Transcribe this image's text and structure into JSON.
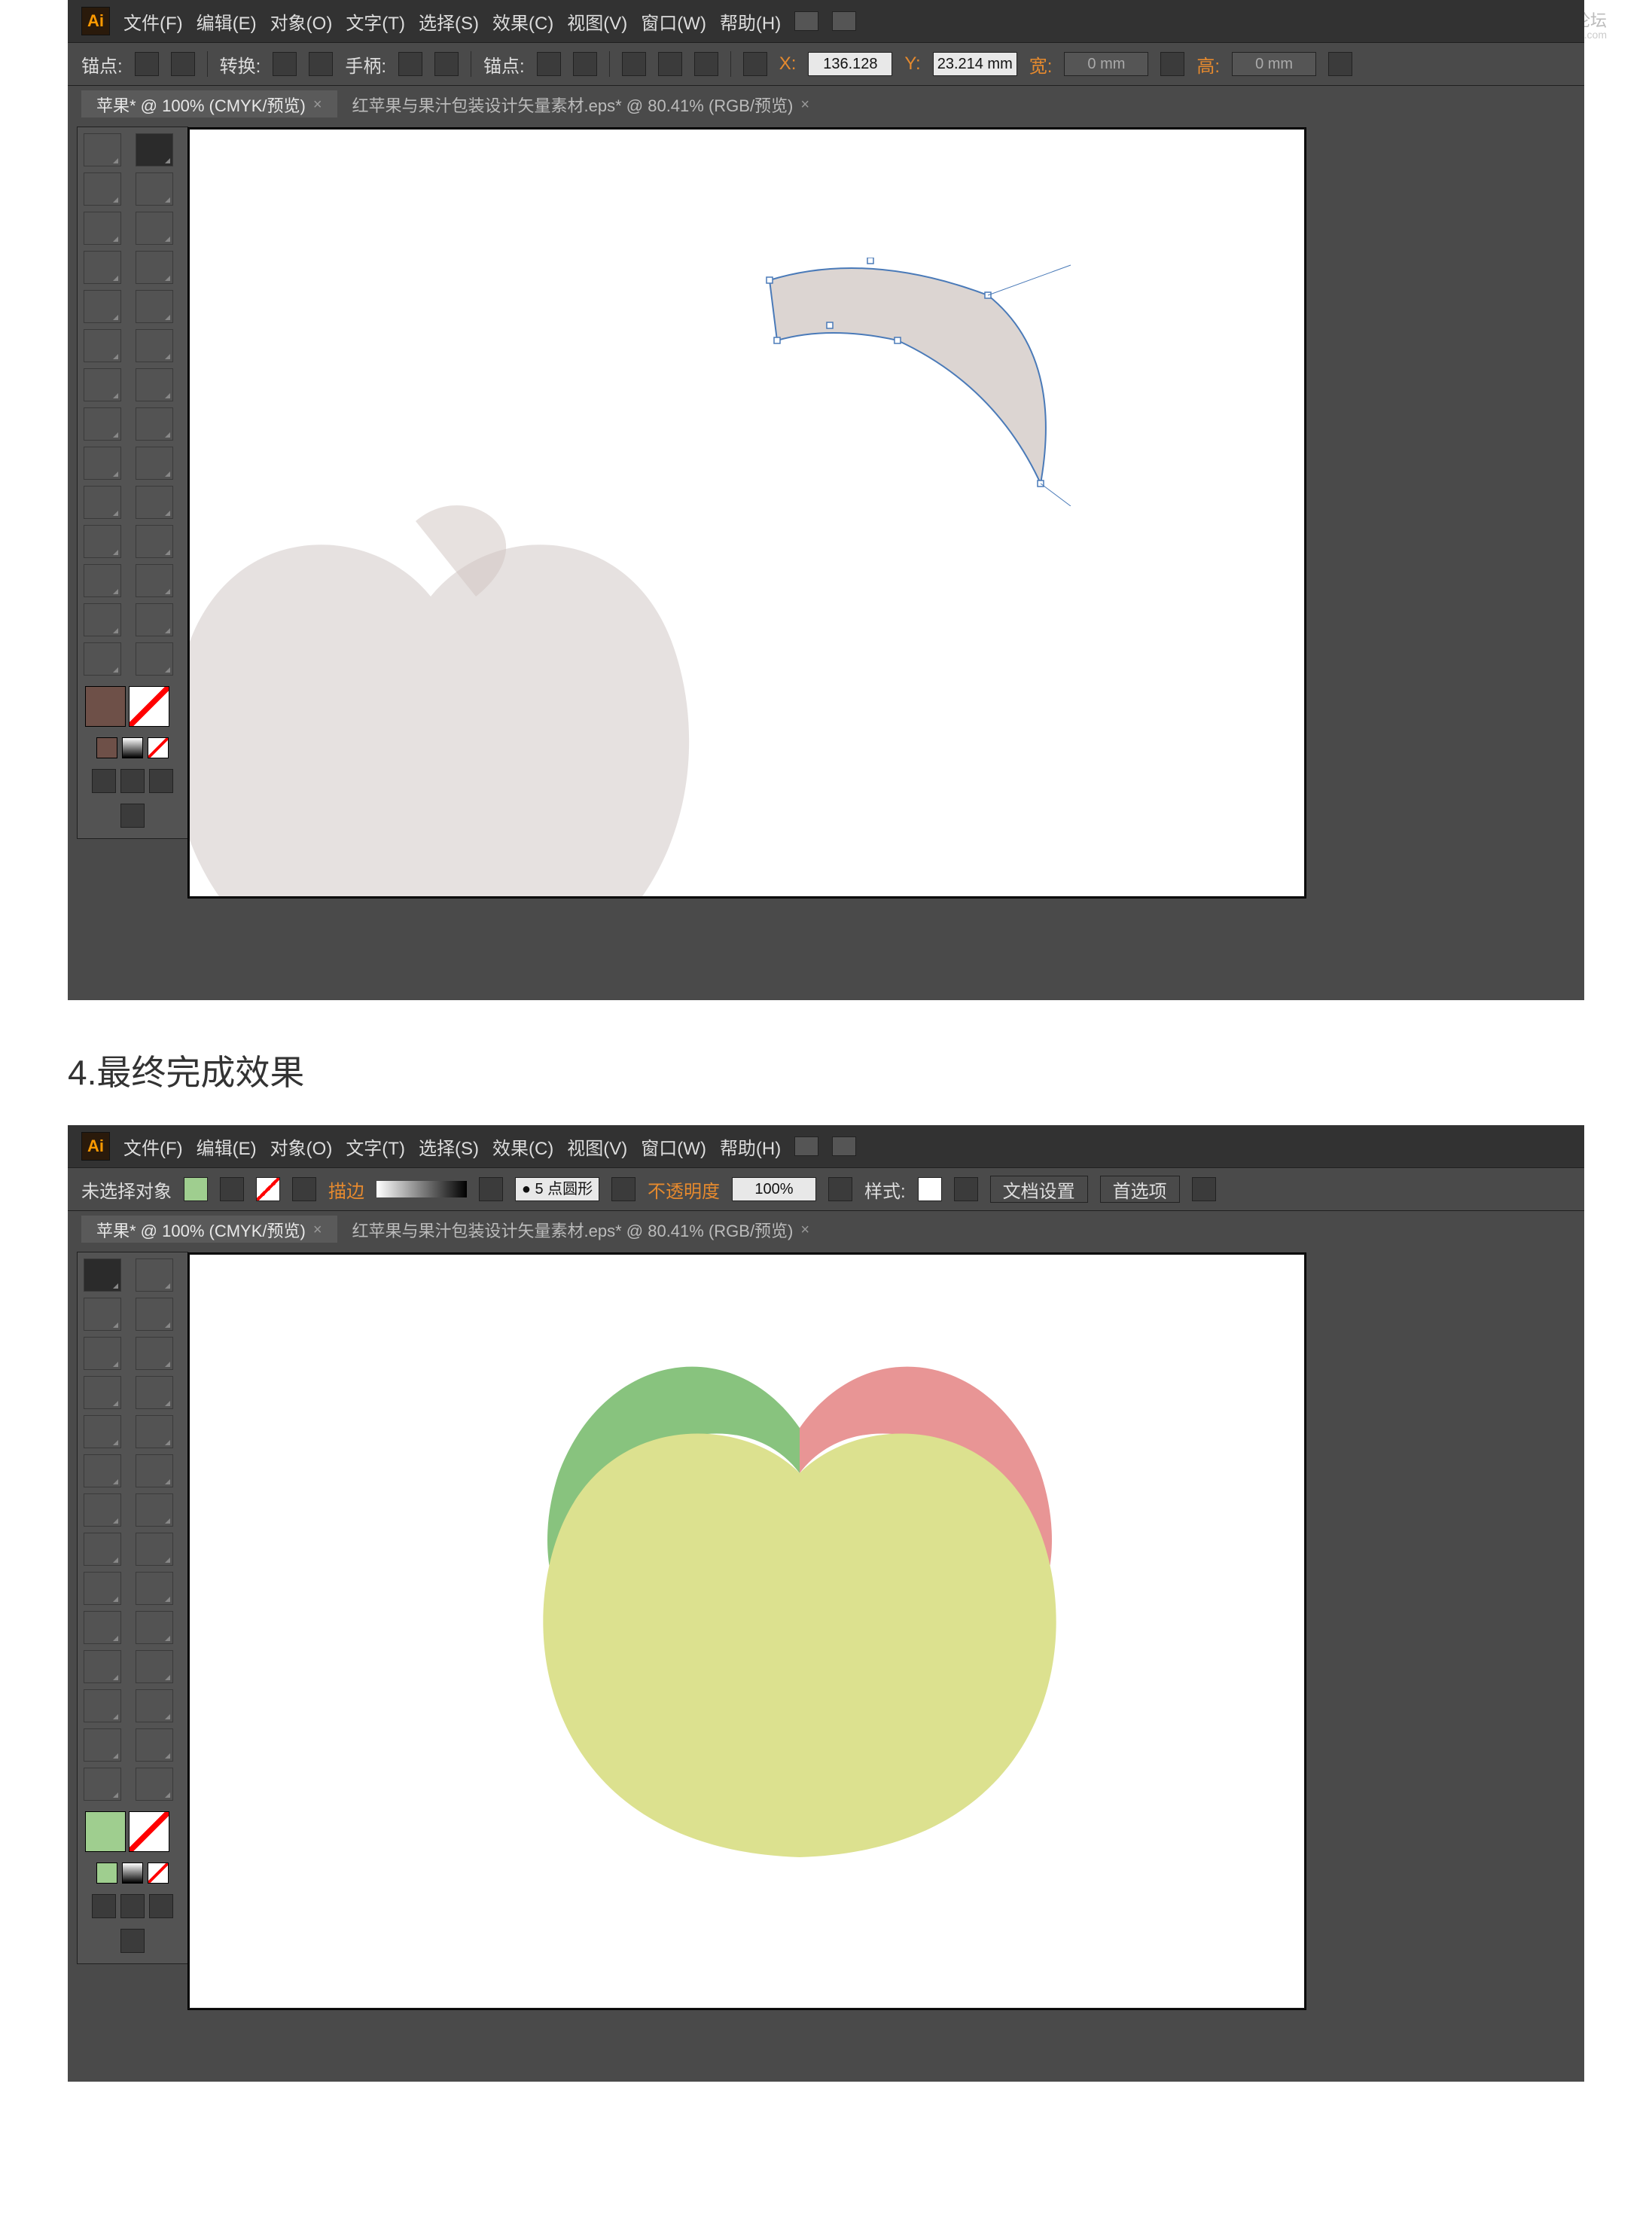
{
  "watermark": {
    "title": "思缘设计论坛",
    "url": "www.missyuan.com"
  },
  "caption": "4.最终完成效果",
  "app_logo": "Ai",
  "menubar": [
    "文件(F)",
    "编辑(E)",
    "对象(O)",
    "文字(T)",
    "选择(S)",
    "效果(C)",
    "视图(V)",
    "窗口(W)",
    "帮助(H)"
  ],
  "ctrl1": {
    "anchor": "锚点:",
    "convert": "转换:",
    "handle": "手柄:",
    "anchor2": "锚点:",
    "x_lbl": "X:",
    "x_val": "136.128",
    "y_lbl": "Y:",
    "y_val": "23.214 mm",
    "w_lbl": "宽:",
    "w_val": "0 mm",
    "h_lbl": "高:",
    "h_val": "0 mm"
  },
  "ctrl2": {
    "nosel": "未选择对象",
    "stroke": "描边",
    "pt_val": "5",
    "pt_label": "点圆形",
    "opacity": "不透明度",
    "opacity_val": "100%",
    "style": "样式:",
    "docset": "文档设置",
    "prefs": "首选项"
  },
  "tabs": {
    "t1": "苹果* @ 100% (CMYK/预览)",
    "t2": "红苹果与果汁包装设计矢量素材.eps* @ 80.41% (RGB/预览)"
  },
  "colors": {
    "ctrl1_fill": "#6e5048",
    "ctrl2_fill": "#9fce8f",
    "canvas_ghost": "#d8d1cf",
    "canvas_leaf": "#dcd5d2",
    "apple_body": "#dce18f",
    "apple_red": "#e89595",
    "apple_green": "#88c37e"
  },
  "tool_grid_rows": 16
}
